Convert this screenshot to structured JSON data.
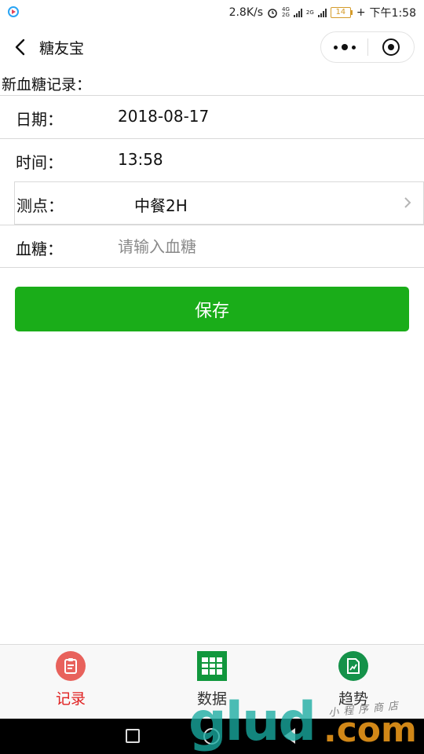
{
  "status_bar": {
    "net_speed": "2.8K/s",
    "sim1_label": "4G",
    "sim1_sub": "2G",
    "sim2_label": "2G",
    "battery": "14",
    "time": "下午1:58"
  },
  "nav": {
    "title": "糖友宝"
  },
  "section_title": "新血糖记录：",
  "form": {
    "date_label": "日期：",
    "date_value": "2018-08-17",
    "time_label": "时间：",
    "time_value": "13:58",
    "point_label": "测点：",
    "point_value": "中餐2H",
    "glucose_label": "血糖：",
    "glucose_placeholder": "请输入血糖",
    "glucose_value": ""
  },
  "save_label": "保存",
  "tabs": [
    {
      "label": "记录",
      "icon": "clipboard-icon",
      "active": true
    },
    {
      "label": "数据",
      "icon": "grid-table-icon",
      "active": false
    },
    {
      "label": "趋势",
      "icon": "trend-chart-icon",
      "active": false
    }
  ],
  "colors": {
    "primary_green": "#1aad19",
    "active_tab": "#e02020",
    "record_icon": "#e8625c",
    "data_icon": "#11973d",
    "trend_icon": "#15924a"
  },
  "watermark": {
    "text": "glud",
    "suffix": ".com",
    "sub": "小程序商店"
  }
}
